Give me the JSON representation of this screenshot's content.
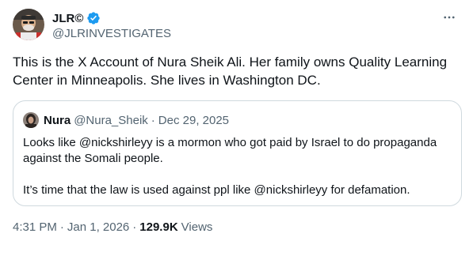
{
  "author": {
    "name": "JLR©",
    "handle": "@JLRINVESTIGATES",
    "verified_color": "#1d9bf0"
  },
  "tweet": {
    "text": "This is the X Account of Nura Sheik Ali. Her family owns Quality Learning Center in Minneapolis. She lives in Washington DC."
  },
  "quote": {
    "name": "Nura",
    "handle": "@Nura_Sheik",
    "separator": "·",
    "date": "Dec 29, 2025",
    "paragraph1": "Looks like @nickshirleyy is a mormon who got paid by Israel to do propaganda against the Somali people.",
    "paragraph2": "It’s time that the law is used against ppl like @nickshirleyy for defamation."
  },
  "meta": {
    "time": "4:31 PM",
    "separator": "·",
    "date": "Jan 1, 2026",
    "views_count": "129.9K",
    "views_label": "Views"
  },
  "icons": {
    "more": "more-dots-icon",
    "verified": "verified-badge-icon"
  },
  "colors": {
    "text": "#0f1419",
    "secondary": "#536471",
    "border": "#cfd9de",
    "accent": "#1d9bf0"
  }
}
